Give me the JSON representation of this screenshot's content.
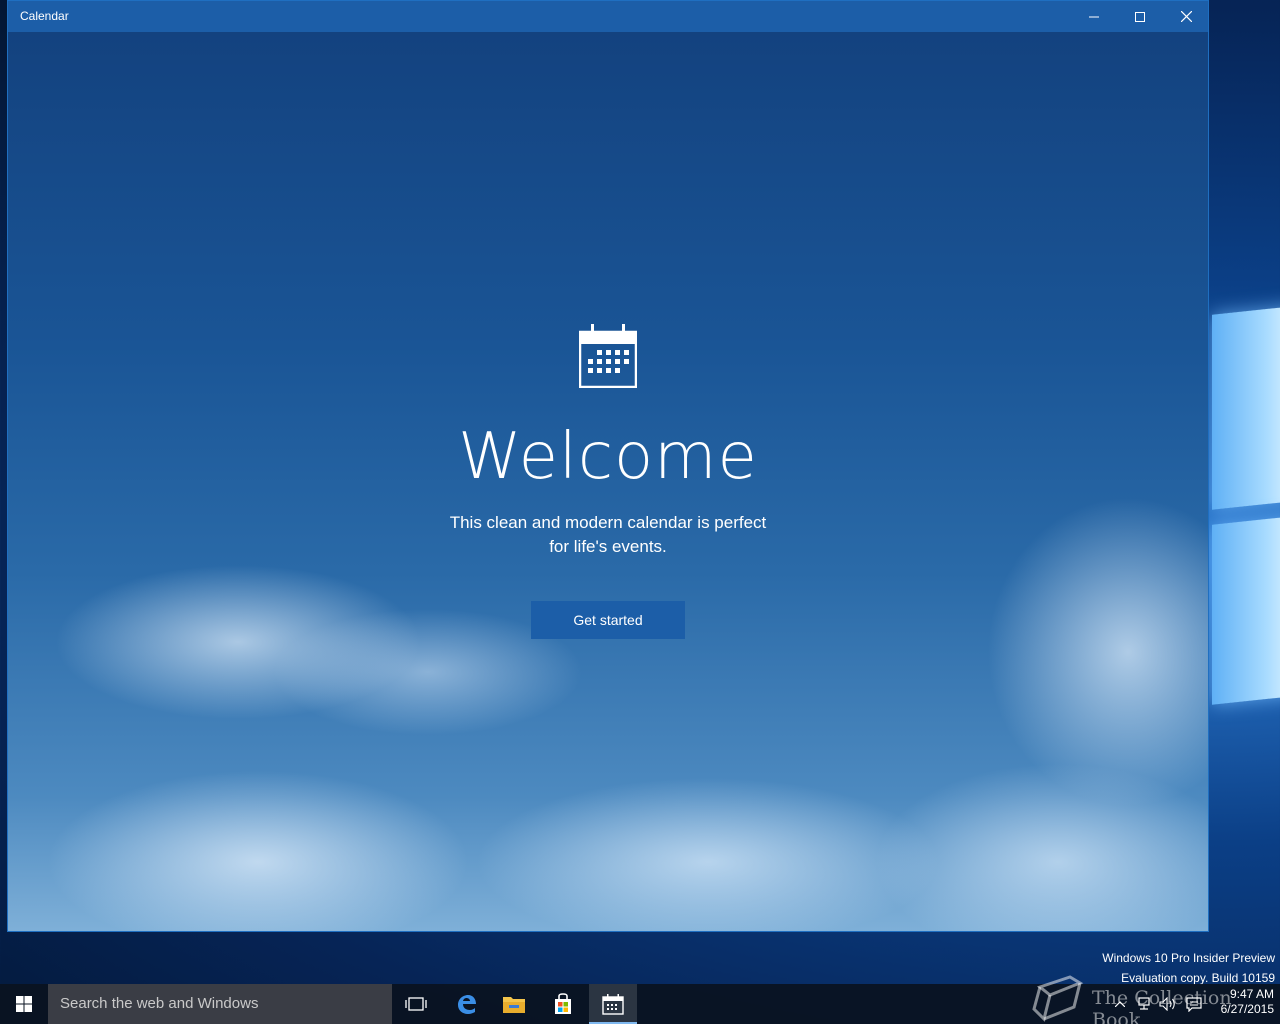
{
  "window": {
    "title": "Calendar",
    "controls": {
      "minimize_icon": "minimize-icon",
      "maximize_icon": "maximize-icon",
      "close_icon": "close-icon"
    }
  },
  "welcome": {
    "icon": "calendar-icon",
    "heading": "Welcome",
    "subtitle": "This clean and modern calendar is perfect for life's events.",
    "button_label": "Get started"
  },
  "desktop": {
    "watermark_line1": "Windows 10 Pro Insider Preview",
    "watermark_line2": "Evaluation copy. Build 10159",
    "overlay_text": "The Collection Book"
  },
  "taskbar": {
    "search_placeholder": "Search the web and Windows",
    "pinned": [
      {
        "name": "task-view-icon"
      },
      {
        "name": "edge-icon"
      },
      {
        "name": "file-explorer-icon"
      },
      {
        "name": "store-icon"
      },
      {
        "name": "calendar-icon",
        "active": true
      }
    ],
    "tray": {
      "chevron_icon": "chevron-up-icon",
      "network_icon": "network-icon",
      "volume_icon": "volume-icon",
      "action_center_icon": "action-center-icon"
    },
    "time": "9:47 AM",
    "date": "6/27/2015"
  },
  "colors": {
    "titlebar": "#1c5ea8",
    "button": "#1c5ea8",
    "taskbar": "#0a1220"
  }
}
